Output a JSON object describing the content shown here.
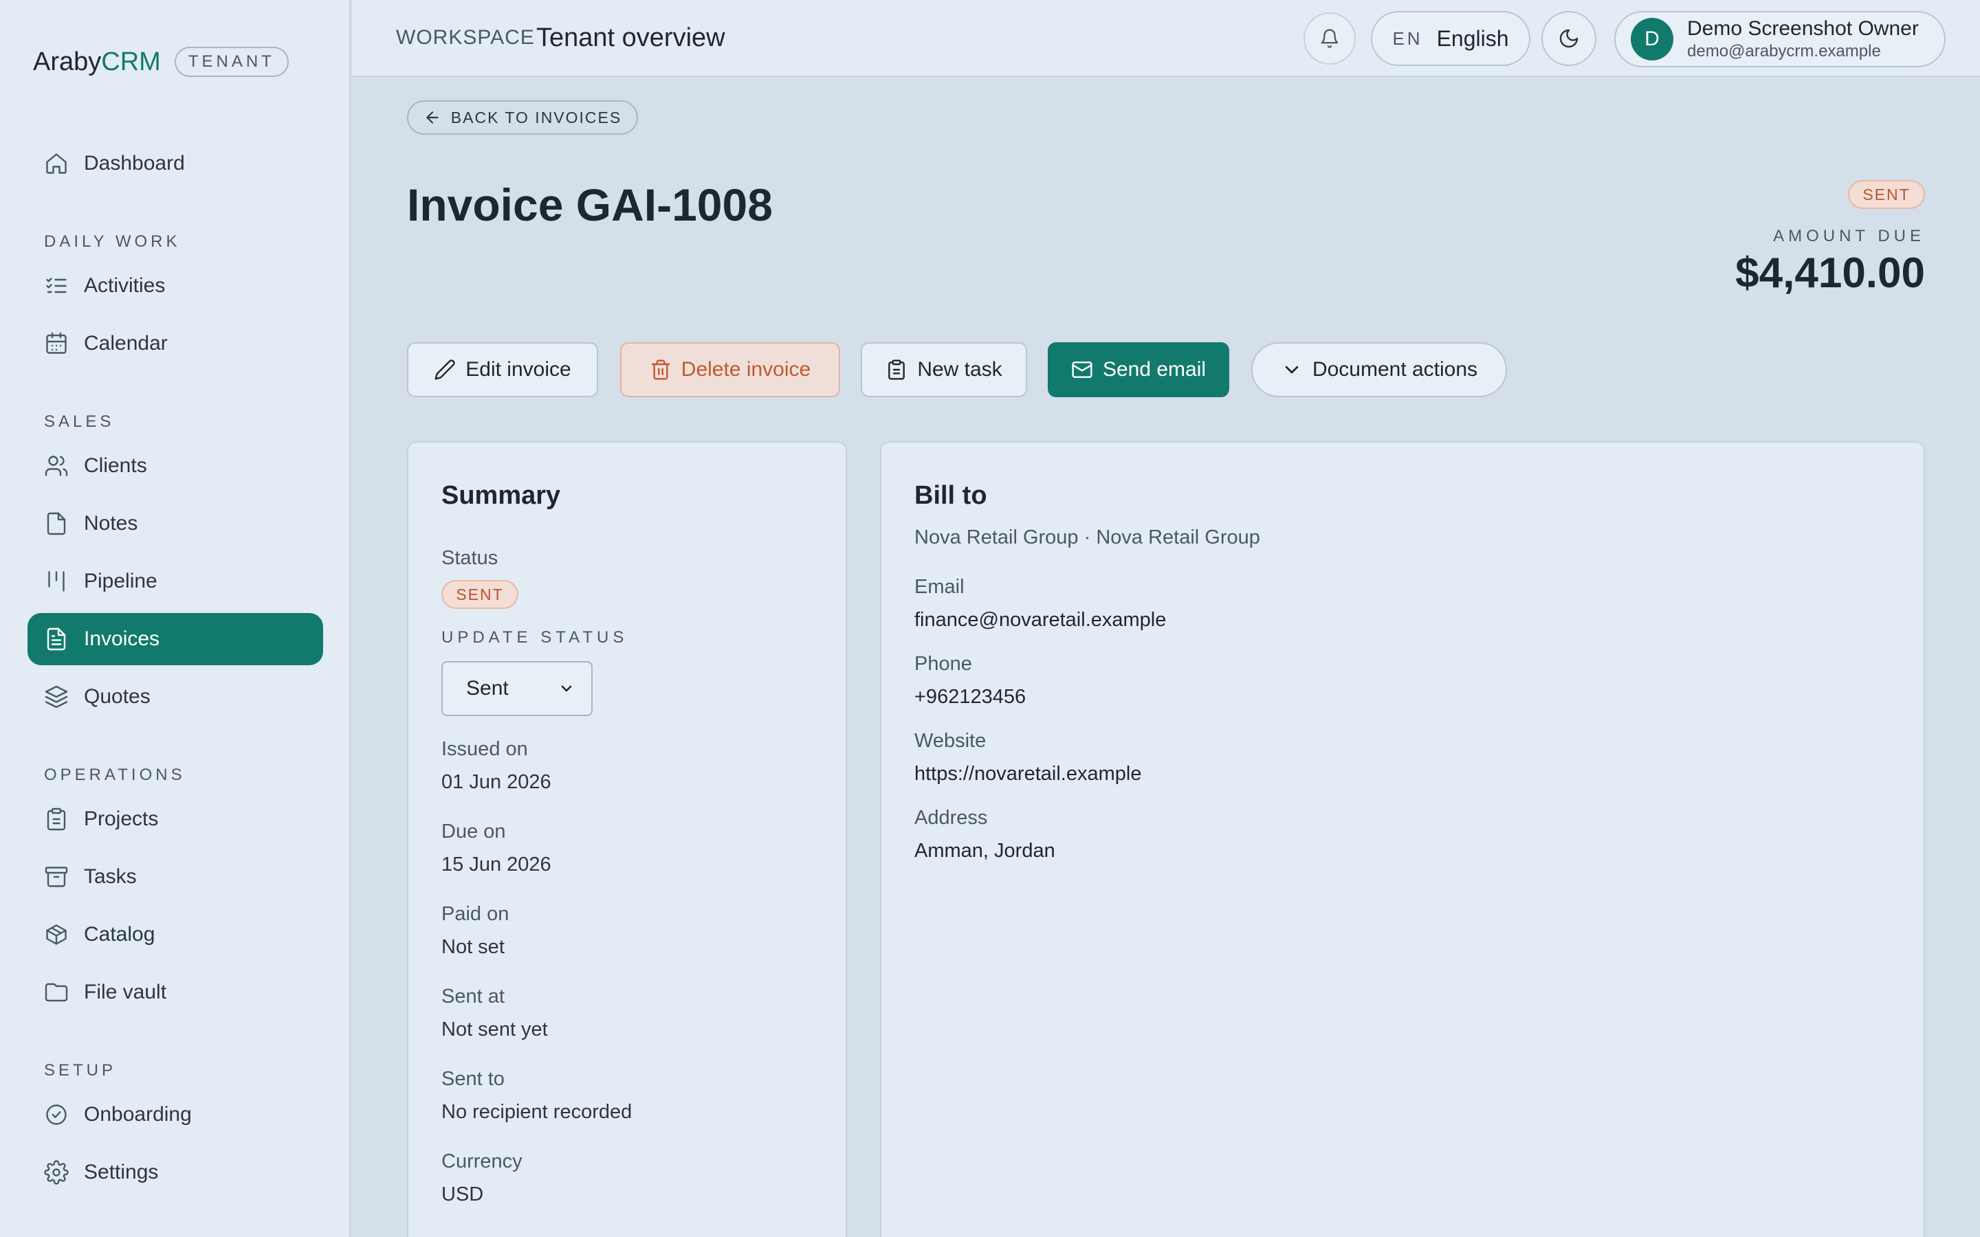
{
  "brand": {
    "name_a": "Araby",
    "name_b": "CRM",
    "badge": "TENANT",
    "accent_color": "#127a6c"
  },
  "sidebar": {
    "items": [
      {
        "type": "item",
        "label": "Dashboard",
        "icon": "home-icon"
      },
      {
        "type": "section",
        "label": "DAILY WORK"
      },
      {
        "type": "item",
        "label": "Activities",
        "icon": "list-check-icon"
      },
      {
        "type": "item",
        "label": "Calendar",
        "icon": "calendar-icon"
      },
      {
        "type": "section",
        "label": "SALES"
      },
      {
        "type": "item",
        "label": "Clients",
        "icon": "users-icon"
      },
      {
        "type": "item",
        "label": "Notes",
        "icon": "file-icon"
      },
      {
        "type": "item",
        "label": "Pipeline",
        "icon": "kanban-icon"
      },
      {
        "type": "item",
        "label": "Invoices",
        "icon": "file-text-icon",
        "active": true
      },
      {
        "type": "item",
        "label": "Quotes",
        "icon": "layers-icon"
      },
      {
        "type": "section",
        "label": "OPERATIONS"
      },
      {
        "type": "item",
        "label": "Projects",
        "icon": "clipboard-icon"
      },
      {
        "type": "item",
        "label": "Tasks",
        "icon": "archive-icon"
      },
      {
        "type": "item",
        "label": "Catalog",
        "icon": "package-icon"
      },
      {
        "type": "item",
        "label": "File vault",
        "icon": "folder-icon"
      },
      {
        "type": "section",
        "label": "SETUP"
      },
      {
        "type": "item",
        "label": "Onboarding",
        "icon": "check-circle-icon"
      },
      {
        "type": "item",
        "label": "Settings",
        "icon": "gear-icon"
      }
    ]
  },
  "topbar": {
    "workspace": "WORKSPACE",
    "title": "Tenant overview",
    "lang_code": "EN",
    "lang_name": "English",
    "user": {
      "initial": "D",
      "name": "Demo Screenshot Owner",
      "email": "demo@arabycrm.example"
    }
  },
  "main": {
    "back_label": "BACK TO INVOICES",
    "title": "Invoice GAI-1008",
    "status": "SENT",
    "amount_due_label": "AMOUNT DUE",
    "amount_due": "$4,410.00",
    "actions": {
      "edit": "Edit invoice",
      "delete": "Delete invoice",
      "new_task": "New task",
      "send_email": "Send email",
      "document_actions": "Document actions"
    }
  },
  "summary": {
    "title": "Summary",
    "status_label": "Status",
    "status_value": "SENT",
    "update_status_label": "UPDATE STATUS",
    "update_status_selected": "Sent",
    "issued_label": "Issued on",
    "issued_value": "01 Jun 2026",
    "due_label": "Due on",
    "due_value": "15 Jun 2026",
    "paid_label": "Paid on",
    "paid_value": "Not set",
    "sent_at_label": "Sent at",
    "sent_at_value": "Not sent yet",
    "sent_to_label": "Sent to",
    "sent_to_value": "No recipient recorded",
    "currency_label": "Currency",
    "currency_value": "USD"
  },
  "bill_to": {
    "title": "Bill to",
    "company": "Nova Retail Group · Nova Retail Group",
    "email_label": "Email",
    "email_value": "finance@novaretail.example",
    "phone_label": "Phone",
    "phone_value": "+962123456",
    "website_label": "Website",
    "website_value": "https://novaretail.example",
    "address_label": "Address",
    "address_value": "Amman, Jordan"
  }
}
